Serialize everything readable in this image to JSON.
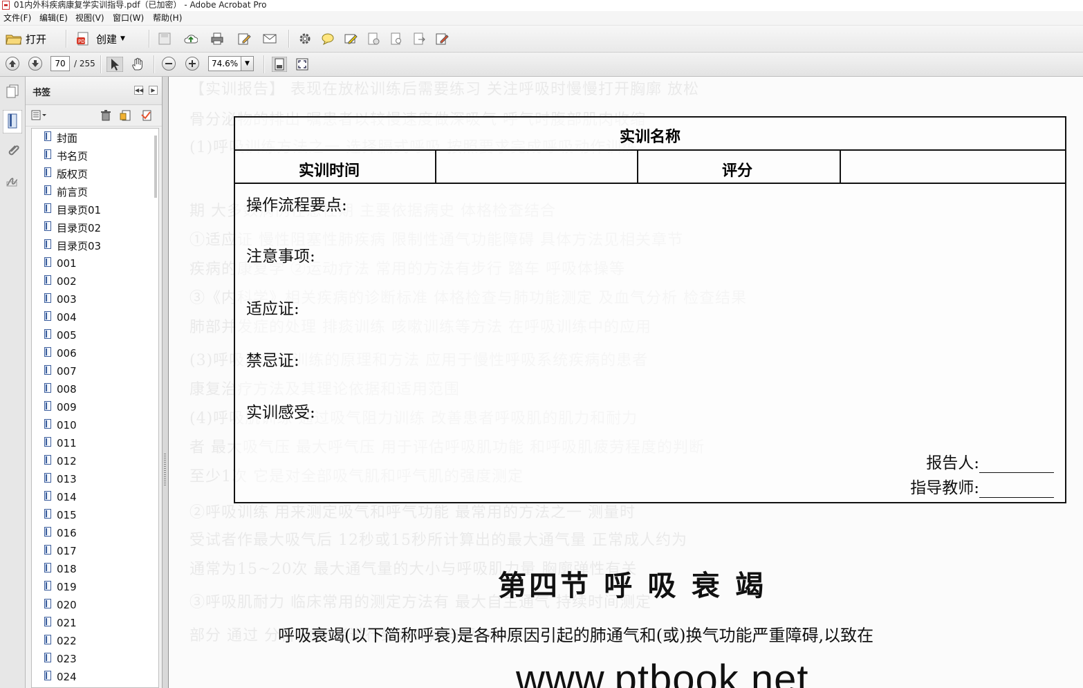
{
  "window": {
    "title": "01内外科疾病康复学实训指导.pdf（已加密） - Adobe Acrobat Pro"
  },
  "menubar": {
    "items": [
      {
        "label": "文件(F)"
      },
      {
        "label": "编辑(E)"
      },
      {
        "label": "视图(V)"
      },
      {
        "label": "窗口(W)"
      },
      {
        "label": "帮助(H)"
      }
    ]
  },
  "toolbar": {
    "open_label": "打开",
    "create_label": "创建"
  },
  "nav": {
    "page_current": "70",
    "page_total": "/ 255",
    "zoom": "74.6%"
  },
  "bookmarks_panel": {
    "title": "书签",
    "items": [
      {
        "label": "封面"
      },
      {
        "label": "书名页"
      },
      {
        "label": "版权页"
      },
      {
        "label": "前言页"
      },
      {
        "label": "目录页01"
      },
      {
        "label": "目录页02"
      },
      {
        "label": "目录页03"
      },
      {
        "label": "001"
      },
      {
        "label": "002"
      },
      {
        "label": "003"
      },
      {
        "label": "004"
      },
      {
        "label": "005"
      },
      {
        "label": "006"
      },
      {
        "label": "007"
      },
      {
        "label": "008"
      },
      {
        "label": "009"
      },
      {
        "label": "010"
      },
      {
        "label": "011"
      },
      {
        "label": "012"
      },
      {
        "label": "013"
      },
      {
        "label": "014"
      },
      {
        "label": "015"
      },
      {
        "label": "016"
      },
      {
        "label": "017"
      },
      {
        "label": "018"
      },
      {
        "label": "019"
      },
      {
        "label": "020"
      },
      {
        "label": "021"
      },
      {
        "label": "022"
      },
      {
        "label": "023"
      },
      {
        "label": "024"
      }
    ]
  },
  "document": {
    "table_title": "实训名称",
    "time_label": "实训时间",
    "score_label": "评分",
    "fields": [
      {
        "label": "操作流程要点:"
      },
      {
        "label": "注意事项:"
      },
      {
        "label": "适应证:"
      },
      {
        "label": "禁忌证:"
      },
      {
        "label": "实训感受:"
      }
    ],
    "reporter_label": "报告人:",
    "teacher_label": "指导教师:",
    "section_title": "第四节  呼 吸 衰 竭",
    "paragraph": "呼吸衰竭(以下简称呼衰)是各种原因引起的肺通气和(或)换气功能严重障碍,以致在",
    "watermark": "www.ptbook.net"
  }
}
